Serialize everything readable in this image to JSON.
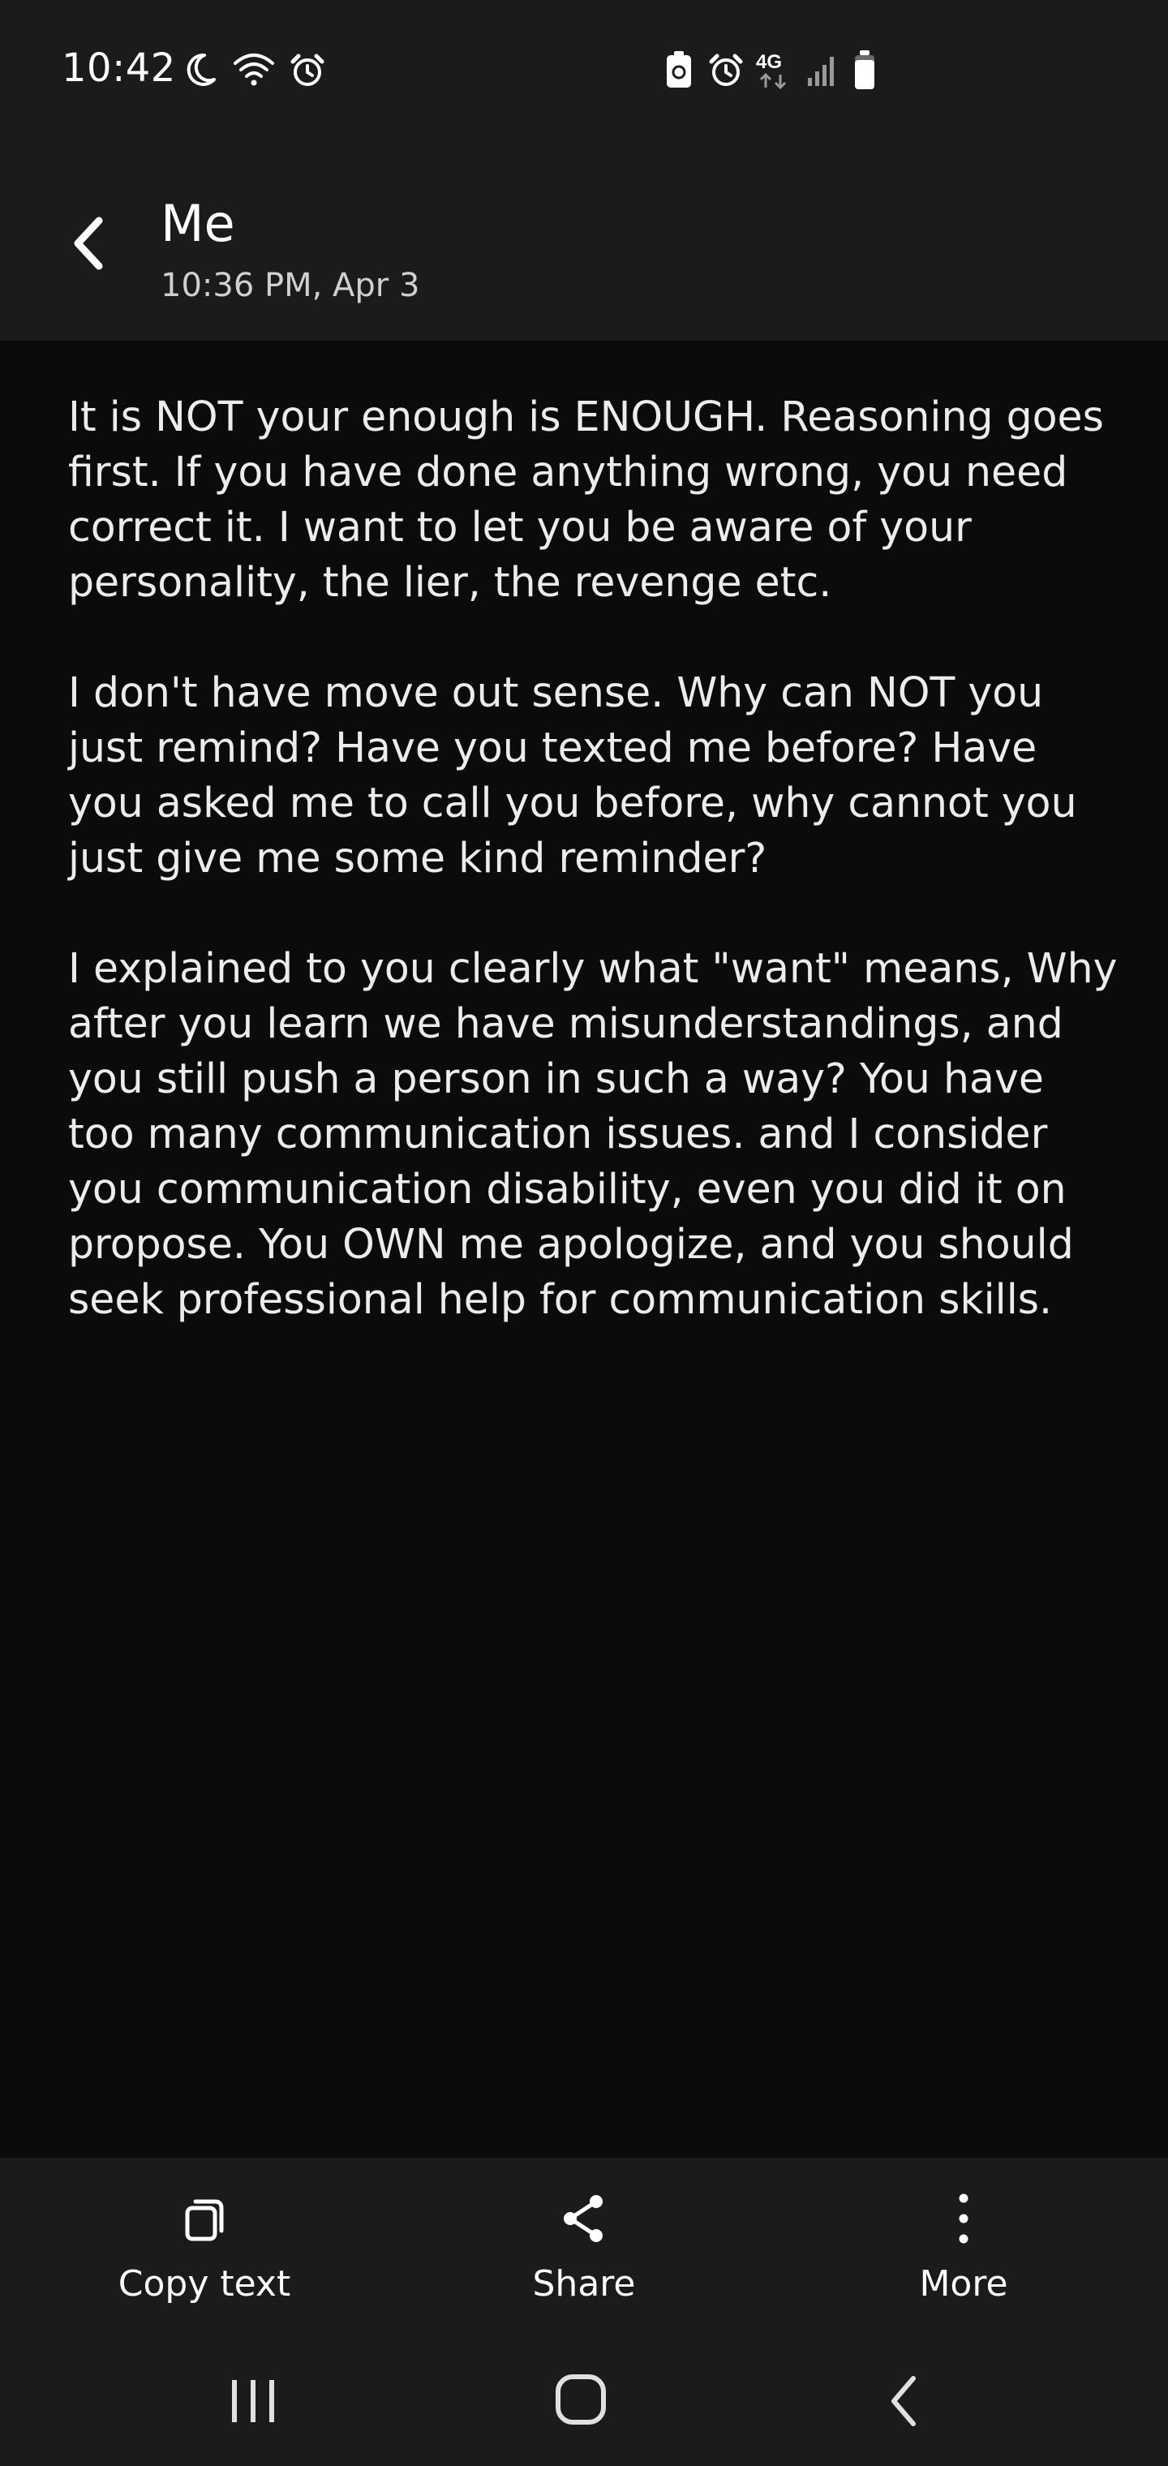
{
  "status_bar": {
    "time": "10:42",
    "left_icons": [
      "moon-icon",
      "wifi-icon",
      "alarm-icon"
    ],
    "right_icons": [
      "recycle-battery-icon",
      "alarm-icon",
      "4g-icon",
      "signal-icon",
      "battery-icon"
    ],
    "network_label": "4G"
  },
  "header": {
    "title": "Me",
    "subtitle": "10:36 PM, Apr 3",
    "back_icon": "chevron-left-icon"
  },
  "message": {
    "paragraphs": [
      "It is NOT your enough is ENOUGH. Reasoning goes first. If you have done anything wrong, you need correct it. I want to let you be aware of your personality, the lier, the revenge etc.",
      "I don't have move out sense. Why can NOT you just remind? Have you texted me before? Have you asked me to call you before, why cannot you just give me some kind reminder?",
      "I explained to you clearly what \"want\" means, Why after you learn we have misunderstandings, and you still push a person in such a way? You have too many communication issues. and I consider you communication disability, even you did it on propose. You OWN me apologize, and you should seek professional help for communication skills."
    ]
  },
  "bottom_actions": [
    {
      "label": "Copy text",
      "icon": "copy-icon"
    },
    {
      "label": "Share",
      "icon": "share-icon"
    },
    {
      "label": "More",
      "icon": "more-vertical-icon"
    }
  ],
  "nav_bar": {
    "buttons": [
      "recent-apps-icon",
      "home-icon",
      "back-icon"
    ]
  },
  "colors": {
    "background": "#0b0b0b",
    "bars": "#1b1b1b",
    "text": "#ececec"
  }
}
